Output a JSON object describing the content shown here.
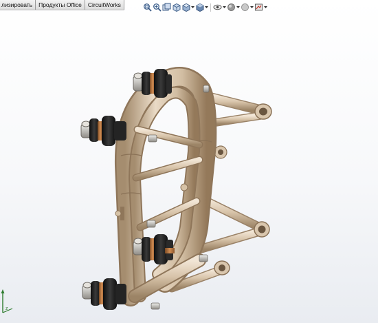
{
  "tabs": [
    {
      "label": "лизировать"
    },
    {
      "label": "Продукты Office"
    },
    {
      "label": "CircuitWorks"
    }
  ],
  "hud_toolbar": {
    "icons": [
      "zoom-to-fit-icon",
      "zoom-area-icon",
      "previous-view-icon",
      "section-view-icon",
      "view-orientation-icon",
      "display-style-icon",
      "hide-show-items-icon",
      "edit-appearance-icon",
      "apply-scene-icon",
      "view-settings-icon"
    ]
  },
  "colors": {
    "tube": "#d9c6ad",
    "tube_shadow": "#a89176",
    "bushing_dark": "#1e1e1e",
    "bushing_copper": "#b4733e",
    "bolt": "#c9c6c0",
    "triad_z": "#2d7b2d"
  }
}
